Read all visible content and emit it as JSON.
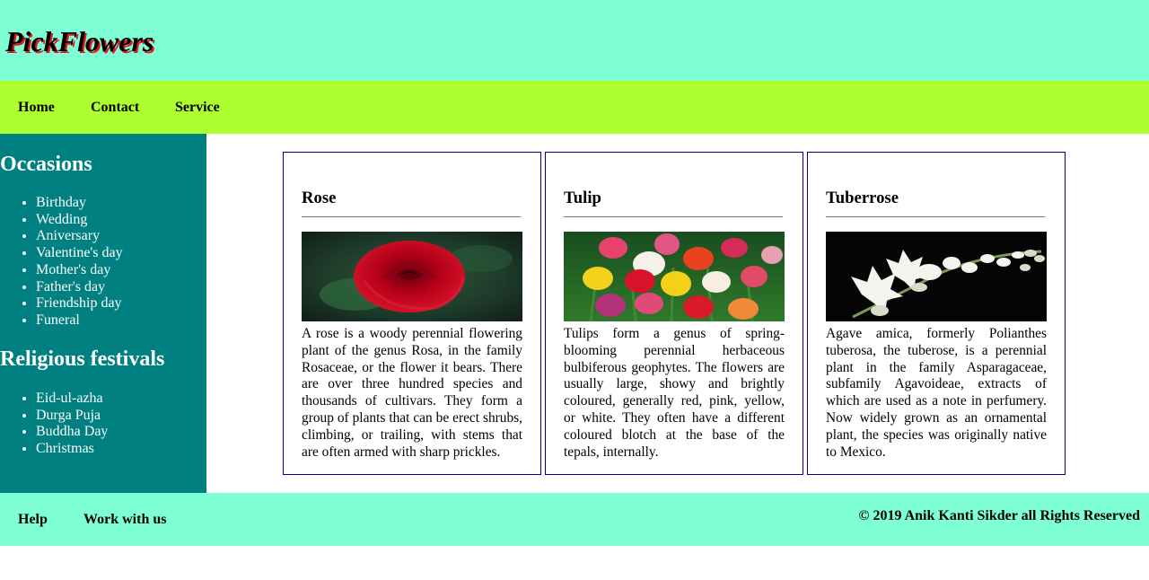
{
  "brand": {
    "name": "PickFlowers"
  },
  "nav": {
    "items": [
      {
        "label": "Home"
      },
      {
        "label": "Contact"
      },
      {
        "label": "Service"
      }
    ]
  },
  "sidebar": {
    "sections": [
      {
        "title": "Occasions",
        "items": [
          "Birthday",
          "Wedding",
          "Aniversary",
          "Valentine's day",
          "Mother's day",
          "Father's day",
          "Friendship day",
          "Funeral"
        ]
      },
      {
        "title": "Religious festivals",
        "items": [
          "Eid-ul-azha",
          "Durga Puja",
          "Buddha Day",
          "Christmas"
        ]
      }
    ]
  },
  "cards": [
    {
      "title": "Rose",
      "description": "A rose is a woody perennial flowering plant of the genus Rosa, in the family Rosaceae, or the flower it bears. There are over three hundred species and thousands of cultivars. They form a group of plants that can be erect shrubs, climbing, or trailing, with stems that are often armed with sharp prickles."
    },
    {
      "title": "Tulip",
      "description": "Tulips form a genus of spring-blooming perennial herbaceous bulbiferous geophytes. The flowers are usually large, showy and brightly coloured, generally red, pink, yellow, or white. They often have a different coloured blotch at the base of the tepals, internally."
    },
    {
      "title": "Tuberrose",
      "description": "Agave amica, formerly Polianthes tuberosa, the tuberose, is a perennial plant in the family Asparagaceae, subfamily Agavoideae, extracts of which are used as a note in perfumery. Now widely grown as an ornamental plant, the species was originally native to Mexico."
    }
  ],
  "footer": {
    "links": [
      {
        "label": "Help"
      },
      {
        "label": "Work with us"
      }
    ],
    "copyright": "© 2019 Anik Kanti Sikder all Rights Reserved"
  },
  "colors": {
    "header_bg": "#7fffd4",
    "nav_bg": "#adff2f",
    "sidebar_bg": "#008080",
    "card_border": "#00008b",
    "brand_shadow": "#e8141c"
  }
}
